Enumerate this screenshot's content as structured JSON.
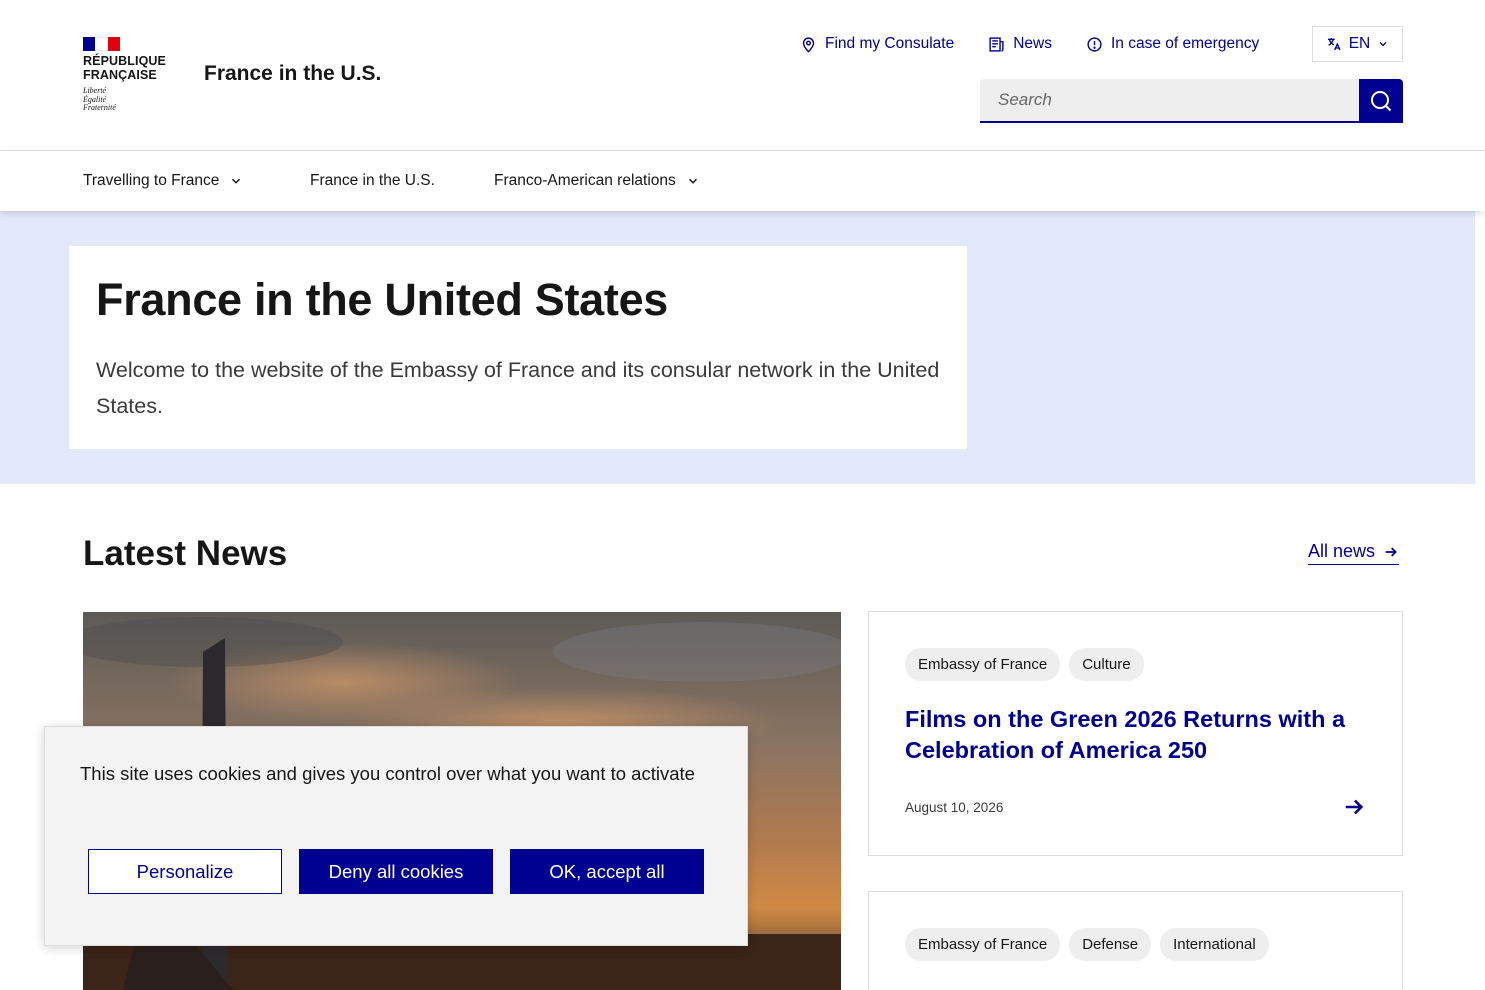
{
  "logo": {
    "title_line1": "RÉPUBLIQUE",
    "title_line2": "FRANÇAISE",
    "motto_line1": "Liberté",
    "motto_line2": "Égalité",
    "motto_line3": "Fraternité"
  },
  "header": {
    "site_title": "France in the U.S.",
    "quick_links": [
      {
        "label": "Find my Consulate",
        "icon": "map-pin-icon"
      },
      {
        "label": "News",
        "icon": "newspaper-icon"
      },
      {
        "label": "In case of emergency",
        "icon": "info-circle-icon"
      }
    ],
    "language": {
      "label": "EN",
      "icon": "translate-icon"
    },
    "search": {
      "placeholder": "Search",
      "button_icon": "search-icon"
    }
  },
  "nav": {
    "items": [
      {
        "label": "Travelling to France",
        "has_dropdown": true
      },
      {
        "label": "France in the U.S.",
        "has_dropdown": false
      },
      {
        "label": "Franco-American relations",
        "has_dropdown": true
      }
    ]
  },
  "hero": {
    "title": "France in the United States",
    "lead": "Welcome to the website of the Embassy of France and its consular network in the United States."
  },
  "news": {
    "heading": "Latest News",
    "all_news_label": "All news",
    "cards": [
      {
        "tags": [
          "Embassy of France",
          "Culture"
        ],
        "title": "Films on the Green 2026 Returns with a Celebration of America 250",
        "date": "August 10, 2026"
      },
      {
        "tags": [
          "Embassy of France",
          "Defense",
          "International"
        ]
      }
    ]
  },
  "cookie_banner": {
    "text": "This site uses cookies and gives you control over what you want to activate",
    "personalize_label": "Personalize",
    "deny_label": "Deny all cookies",
    "accept_label": "OK, accept all"
  },
  "colors": {
    "primary_blue": "#000091",
    "hero_background": "#e3e8fa",
    "flag_blue": "#000091",
    "flag_red": "#e1000f",
    "tag_background": "#eeeeee"
  }
}
